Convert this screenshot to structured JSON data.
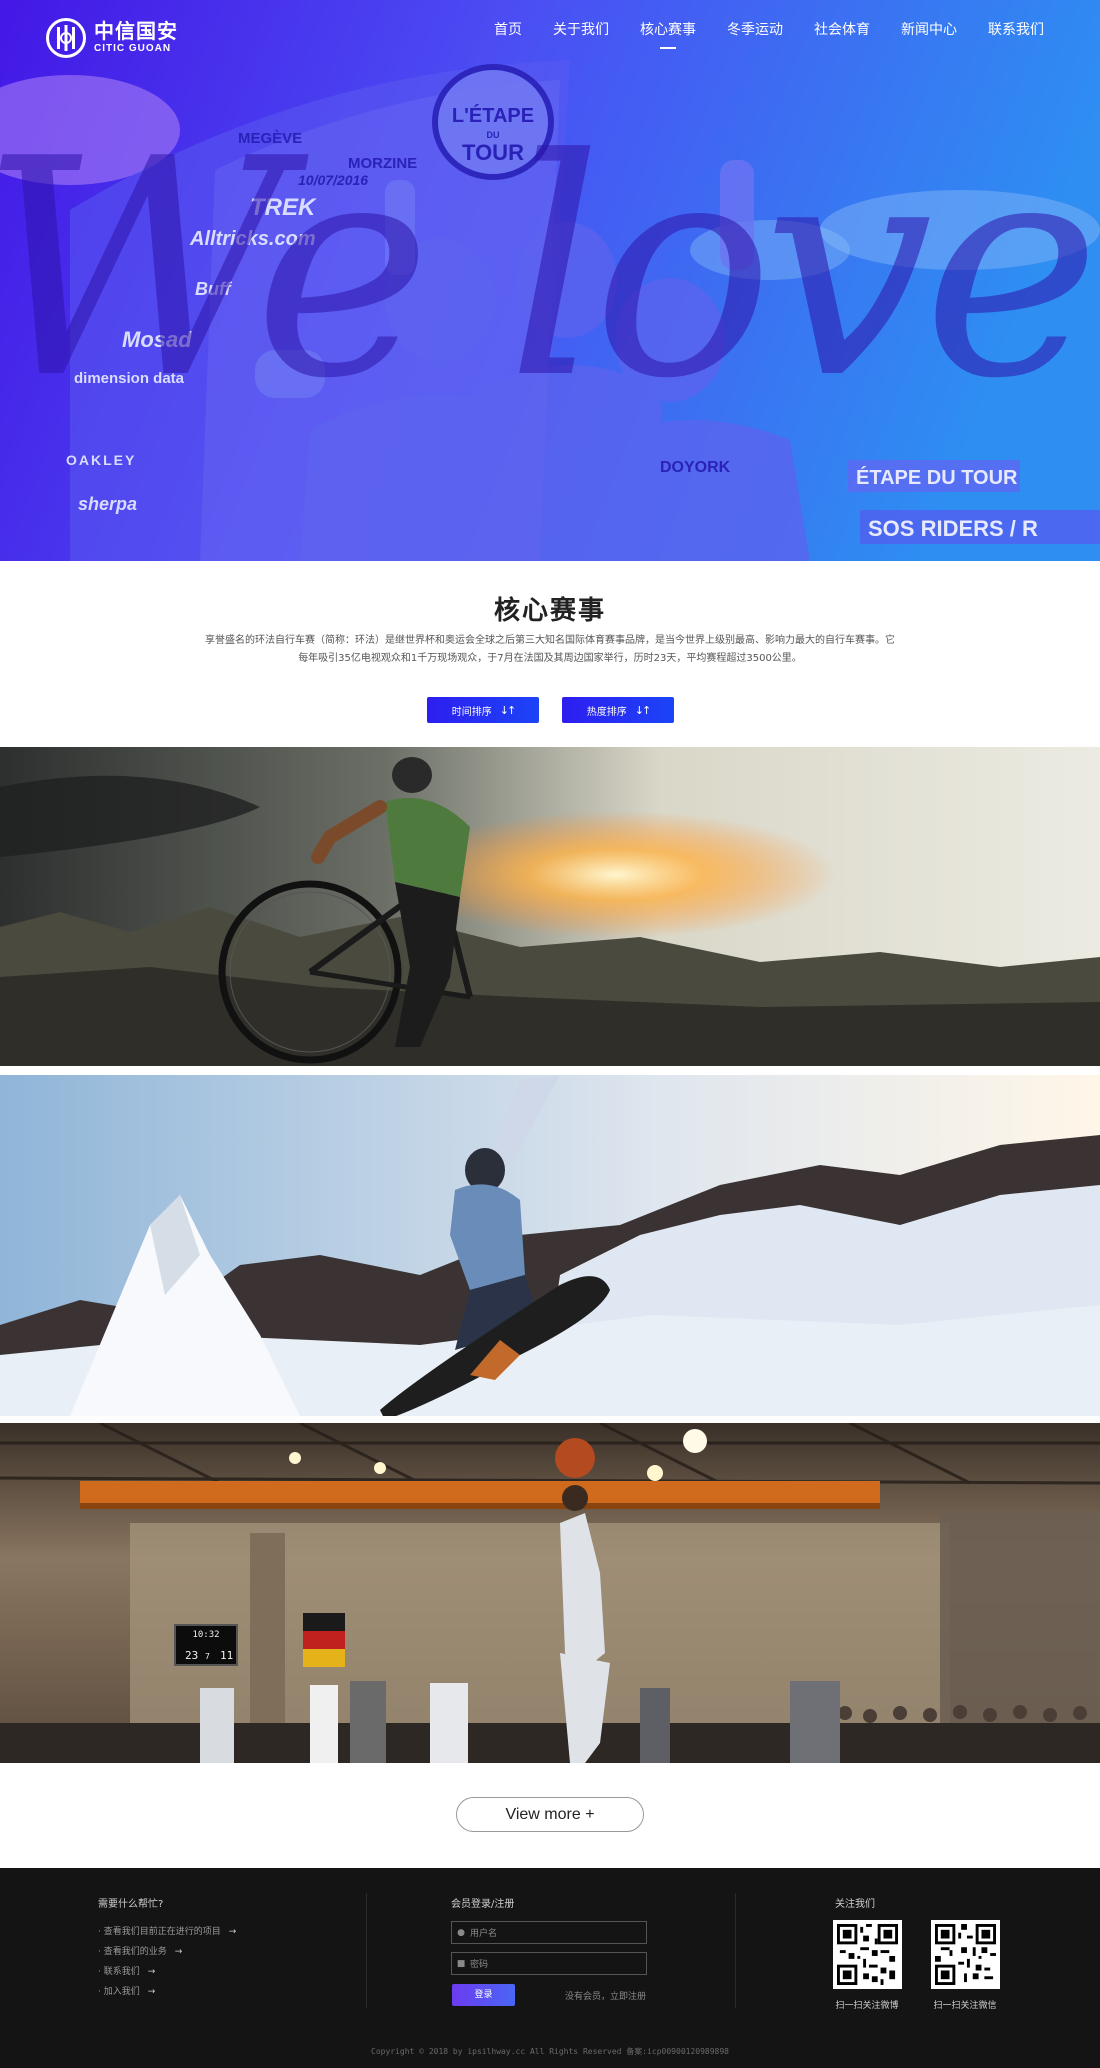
{
  "brand": {
    "name_cn": "中信国安",
    "name_en": "CITIC GUOAN",
    "logo_icon": "citic-logo-icon"
  },
  "nav": {
    "items": [
      {
        "label": "首页",
        "active": false
      },
      {
        "label": "关于我们",
        "active": false
      },
      {
        "label": "核心赛事",
        "active": true
      },
      {
        "label": "冬季运动",
        "active": false
      },
      {
        "label": "社会体育",
        "active": false
      },
      {
        "label": "新闻中心",
        "active": false
      },
      {
        "label": "联系我们",
        "active": false
      }
    ]
  },
  "hero": {
    "script_text": "We love",
    "photo_text": {
      "banner_line1": "MEGÈVE",
      "banner_line2": "MORZINE",
      "date": "10/07/2016",
      "badge_top": "L'ÉTAPE",
      "badge_mid": "DU",
      "badge_bottom": "TOUR",
      "sponsors": [
        "TREK",
        "Alltricks.com",
        "Buff",
        "Mosad",
        "dimension data",
        "OAKLEY",
        "sherpa"
      ],
      "sign1": "ÉTAPE DU TOUR",
      "sign2": "SOS RIDERS / R",
      "jersey": "DOYORK"
    },
    "overlay_color": "#3d2cf0"
  },
  "core_events": {
    "title": "核心赛事",
    "description": "享誉盛名的环法自行车赛（简称：环法）是继世界杯和奥运会全球之后第三大知名国际体育赛事品牌，是当今世界上级别最高、影响力最大的自行车赛事。它每年吸引35亿电视观众和1千万现场观众，于7月在法国及其周边国家举行，历时23天，平均赛程超过3500公里。",
    "sort_time": "时间排序",
    "sort_hot": "热度排序",
    "sort_icon": "sort-arrows-icon",
    "events": [
      {
        "name": "cycling"
      },
      {
        "name": "snowboarding"
      },
      {
        "name": "basketball",
        "scoreboard": [
          "10:32",
          "23",
          "7",
          "11"
        ]
      }
    ],
    "view_more": "View more +"
  },
  "footer": {
    "help_title": "需要什么帮忙?",
    "help_links": [
      "查看我们目前正在进行的项目",
      "查看我们的业务",
      "联系我们",
      "加入我们"
    ],
    "member_title": "会员登录/注册",
    "username_placeholder": "用户名",
    "password_placeholder": "密码",
    "login_label": "登录",
    "register_text": "没有会员，立即注册",
    "follow_title": "关注我们",
    "weibo_caption": "扫一扫关注微博",
    "wechat_caption": "扫一扫关注微信",
    "copyright": "Copyright © 2018 by ipsilhway.cc    All Rights Reserved    备案:icp00900120989898"
  },
  "colors": {
    "accent": "#2d1ef0",
    "accent2": "#1c44f7",
    "footer_bg": "#141414"
  }
}
